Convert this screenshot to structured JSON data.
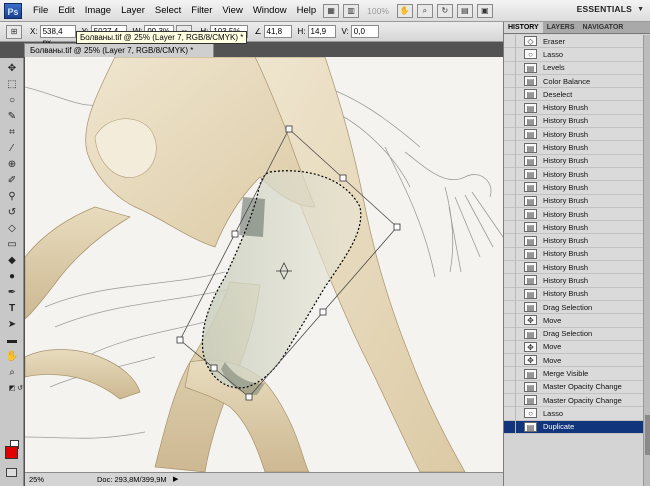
{
  "app": {
    "logo": "Ps",
    "workspace": "ESSENTIALS"
  },
  "menu": [
    "File",
    "Edit",
    "Image",
    "Layer",
    "Select",
    "Filter",
    "View",
    "Window",
    "Help"
  ],
  "menubar_zoom": "100%",
  "options": {
    "x_label": "X:",
    "x_value": "538,4 px",
    "y_label": "Y:",
    "y_value": "5027,4 px",
    "w_label": "W:",
    "w_value": "99,3%",
    "h_label": "H:",
    "h_value": "103,5%",
    "angle_value": "41,8",
    "hskew_label": "H:",
    "hskew_value": "14,9",
    "vskew_label": "V:",
    "vskew_value": "0,0"
  },
  "document": {
    "tab_title": "Болваны.tif @ 25% (Layer 7, RGB/8/CMYK) *",
    "tooltip": "Болваны.tif @ 25% (Layer 7, RGB/8/CMYK) *",
    "zoom": "25%",
    "doc_info": "Doc: 293,8M/399,9M"
  },
  "colors": {
    "foreground": "#e10000",
    "background": "#ffffff",
    "selection": "#10357c"
  },
  "panel": {
    "tabs": [
      "HISTORY",
      "LAYERS",
      "NAVIGATOR"
    ],
    "active_tab": "HISTORY",
    "history": [
      {
        "icon": "eraser-icon",
        "glyph": "◇",
        "label": "Eraser"
      },
      {
        "icon": "lasso-icon",
        "glyph": "○",
        "label": "Lasso"
      },
      {
        "icon": "adjustment-icon",
        "glyph": "▤",
        "label": "Levels"
      },
      {
        "icon": "adjustment-icon",
        "glyph": "▤",
        "label": "Color Balance"
      },
      {
        "icon": "adjustment-icon",
        "glyph": "▤",
        "label": "Deselect"
      },
      {
        "icon": "adjustment-icon",
        "glyph": "▤",
        "label": "History Brush"
      },
      {
        "icon": "adjustment-icon",
        "glyph": "▤",
        "label": "History Brush"
      },
      {
        "icon": "adjustment-icon",
        "glyph": "▤",
        "label": "History Brush"
      },
      {
        "icon": "adjustment-icon",
        "glyph": "▤",
        "label": "History Brush"
      },
      {
        "icon": "adjustment-icon",
        "glyph": "▤",
        "label": "History Brush"
      },
      {
        "icon": "adjustment-icon",
        "glyph": "▤",
        "label": "History Brush"
      },
      {
        "icon": "adjustment-icon",
        "glyph": "▤",
        "label": "History Brush"
      },
      {
        "icon": "adjustment-icon",
        "glyph": "▤",
        "label": "History Brush"
      },
      {
        "icon": "adjustment-icon",
        "glyph": "▤",
        "label": "History Brush"
      },
      {
        "icon": "adjustment-icon",
        "glyph": "▤",
        "label": "History Brush"
      },
      {
        "icon": "adjustment-icon",
        "glyph": "▤",
        "label": "History Brush"
      },
      {
        "icon": "adjustment-icon",
        "glyph": "▤",
        "label": "History Brush"
      },
      {
        "icon": "adjustment-icon",
        "glyph": "▤",
        "label": "History Brush"
      },
      {
        "icon": "adjustment-icon",
        "glyph": "▤",
        "label": "History Brush"
      },
      {
        "icon": "adjustment-icon",
        "glyph": "▤",
        "label": "History Brush"
      },
      {
        "icon": "adjustment-icon",
        "glyph": "▤",
        "label": "Drag Selection"
      },
      {
        "icon": "move-icon",
        "glyph": "✥",
        "label": "Move"
      },
      {
        "icon": "adjustment-icon",
        "glyph": "▤",
        "label": "Drag Selection"
      },
      {
        "icon": "move-icon",
        "glyph": "✥",
        "label": "Move"
      },
      {
        "icon": "move-icon",
        "glyph": "✥",
        "label": "Move"
      },
      {
        "icon": "adjustment-icon",
        "glyph": "▤",
        "label": "Merge Visible"
      },
      {
        "icon": "adjustment-icon",
        "glyph": "▤",
        "label": "Master Opacity Change"
      },
      {
        "icon": "adjustment-icon",
        "glyph": "▤",
        "label": "Master Opacity Change"
      },
      {
        "icon": "lasso-icon",
        "glyph": "○",
        "label": "Lasso"
      },
      {
        "icon": "adjustment-icon",
        "glyph": "▤",
        "label": "Duplicate",
        "selected": true
      }
    ]
  }
}
